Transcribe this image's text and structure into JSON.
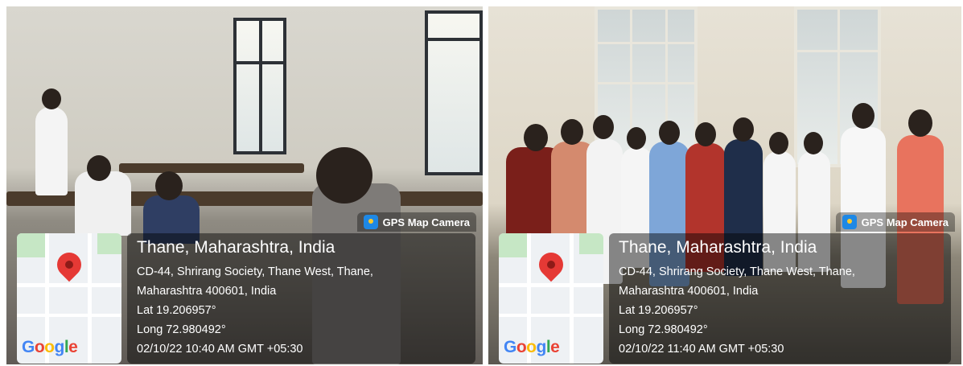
{
  "photos": [
    {
      "badge": "GPS Map Camera",
      "city": "Thane, Maharashtra, India",
      "address_line1": "CD-44, Shrirang Society, Thane West, Thane,",
      "address_line2": "Maharashtra 400601, India",
      "lat": "Lat 19.206957°",
      "long": "Long 72.980492°",
      "timestamp": "02/10/22 10:40 AM GMT +05:30",
      "map_logo": "Google"
    },
    {
      "badge": "GPS Map Camera",
      "city": "Thane, Maharashtra, India",
      "address_line1": "CD-44, Shrirang Society, Thane West, Thane,",
      "address_line2": "Maharashtra 400601, India",
      "lat": "Lat 19.206957°",
      "long": "Long 72.980492°",
      "timestamp": "02/10/22 11:40 AM GMT +05:30",
      "map_logo": "Google"
    }
  ],
  "icons": {
    "badge_icon": "map-pin-icon",
    "map_marker": "location-marker-icon"
  },
  "colors": {
    "overlay": "#000000",
    "marker": "#e53935",
    "badge_icon": "#1e88e5"
  }
}
